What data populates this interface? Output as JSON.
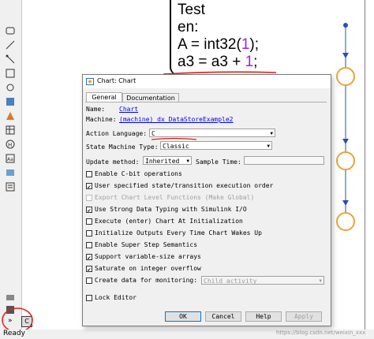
{
  "state_block": {
    "lines": [
      "Test",
      "en:",
      "A = int32(",
      "1",
      ");",
      "a3 = a3 + ",
      "1",
      ";"
    ]
  },
  "status_bar": {
    "ready": "Ready",
    "watermark": "https://blog.csdn.net/weixin_xxx"
  },
  "palette": {
    "icons": [
      "state-icon",
      "transition-icon",
      "default-transition-icon",
      "box-icon",
      "junction-icon",
      "simulink-function-icon",
      "matlab-function-icon",
      "truth-table-icon",
      "history-icon",
      "annotation-icon",
      "image-icon",
      "model-explorer-icon",
      "explore-icon",
      "chart-action-language-icon"
    ],
    "action_lang_badge": "C"
  },
  "dialog": {
    "title": "Chart: Chart",
    "tabs": [
      "General",
      "Documentation"
    ],
    "name_label": "Name:",
    "name_value": "Chart",
    "machine_label": "Machine:",
    "machine_value": "(machine) dx DataStoreExample2",
    "action_language_label": "Action Language:",
    "action_language_value": "C",
    "state_machine_type_label": "State Machine Type:",
    "state_machine_type_value": "Classic",
    "update_method_label": "Update method:",
    "update_method_value": "Inherited",
    "sample_time_label": "Sample Time:",
    "sample_time_value": "",
    "options": [
      {
        "label": "Enable C-bit operations",
        "checked": false,
        "enabled": true
      },
      {
        "label": "User specified state/transition execution order",
        "checked": true,
        "enabled": true
      },
      {
        "label": "Export Chart Level Functions (Make Global)",
        "checked": false,
        "enabled": false
      },
      {
        "label": "Use Strong Data Typing with Simulink I/O",
        "checked": true,
        "enabled": true
      },
      {
        "label": "Execute (enter) Chart At Initialization",
        "checked": false,
        "enabled": true
      },
      {
        "label": "Initialize Outputs Every Time Chart Wakes Up",
        "checked": false,
        "enabled": true
      },
      {
        "label": "Enable Super Step Semantics",
        "checked": false,
        "enabled": true
      },
      {
        "label": "Support variable-size arrays",
        "checked": true,
        "enabled": true
      },
      {
        "label": "Saturate on integer overflow",
        "checked": true,
        "enabled": true
      },
      {
        "label": "Create data for monitoring:",
        "checked": false,
        "enabled": true
      }
    ],
    "monitoring_value": "Child activity",
    "lock_editor_label": "Lock Editor",
    "buttons": [
      "OK",
      "Cancel",
      "Help",
      "Apply"
    ]
  },
  "colors": {
    "accent_red": "#e0201c",
    "number_purple": "#a020f0",
    "link_blue": "#0000ee",
    "state_orange": "#e8a33a"
  }
}
